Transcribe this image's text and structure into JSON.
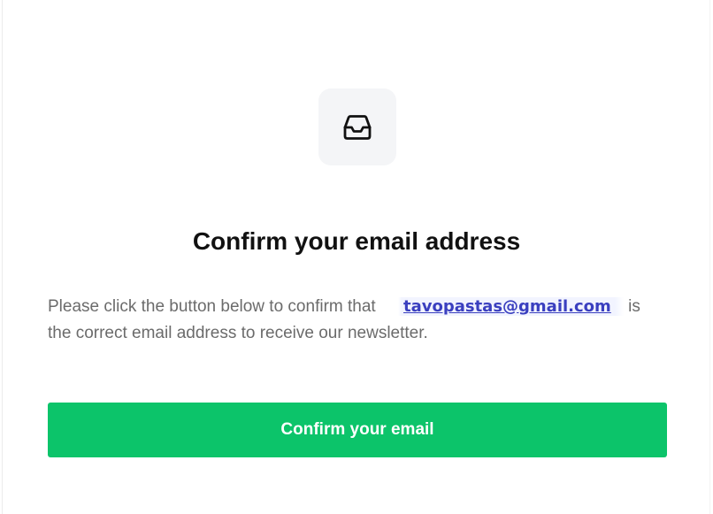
{
  "icon": {
    "name": "inbox-icon"
  },
  "heading": {
    "title": "Confirm your email address"
  },
  "message": {
    "prefix": "Please click the button below to confirm that",
    "email": "tavopastas@gmail.com",
    "suffix": "is the correct email address to receive our newsletter."
  },
  "cta": {
    "label": "Confirm your email"
  },
  "colors": {
    "button": "#0cc46a",
    "link": "#3a3fbf",
    "title": "#111111",
    "body": "#6b6b6b",
    "icon_tile": "#f4f5f7"
  }
}
